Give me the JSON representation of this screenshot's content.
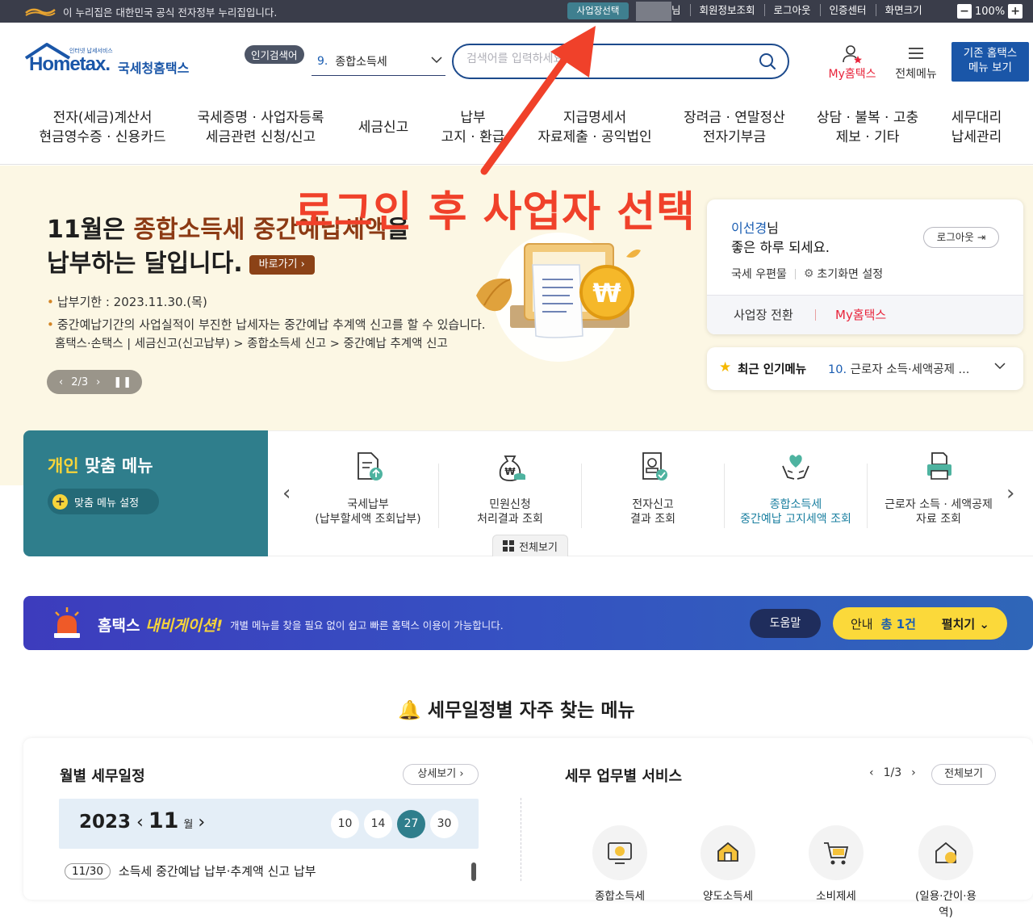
{
  "gov_bar": {
    "notice": "이 누리집은 대한민국 공식 전자정부 누리집입니다.",
    "biz_select": "사업장선택",
    "user_suffix": "님",
    "links": [
      "회원정보조회",
      "로그아웃",
      "인증센터",
      "화면크기"
    ],
    "zoom": "100%"
  },
  "header": {
    "logo_small": "인터넷 납세서비스",
    "logo_main": "Hometax.",
    "logo_kor": "국세청홈택스",
    "popular_label": "인기검색어",
    "popular_num": "9.",
    "popular_term": "종합소득세",
    "search_placeholder": "검색어를 입력하세요",
    "my_hometax": "My홈택스",
    "all_menu": "전체메뉴",
    "old_home_line1": "기존 홈택스",
    "old_home_line2": "메뉴 보기"
  },
  "gnb": [
    {
      "l1": "전자(세금)계산서",
      "l2": "현금영수증 · 신용카드"
    },
    {
      "l1": "국세증명 · 사업자등록",
      "l2": "세금관련 신청/신고"
    },
    {
      "l1": "세금신고",
      "l2": ""
    },
    {
      "l1": "납부",
      "l2": "고지 · 환급"
    },
    {
      "l1": "지급명세서",
      "l2": "자료제출 · 공익법인"
    },
    {
      "l1": "장려금 · 연말정산",
      "l2": "전자기부금"
    },
    {
      "l1": "상담 · 불복 · 고충",
      "l2": "제보 · 기타"
    },
    {
      "l1": "세무대리",
      "l2": "납세관리"
    }
  ],
  "banner": {
    "title_pre": "11월은 ",
    "title_hl": "종합소득세 중간예납세액",
    "title_post": "을",
    "title_line2": "납부하는 달입니다.",
    "go_label": "바로가기",
    "deadline": "납부기한 : 2023.11.30.(목)",
    "desc": "중간예납기간의 사업실적이 부진한 납세자는 중간예납 추계액 신고를 할 수 있습니다.",
    "path": "홈택스·손택스 | 세금신고(신고납부) > 종합소득세 신고 > 중간예납 추계액 신고",
    "slide_pos": "2/3"
  },
  "annotation": {
    "text": "로그인 후 사업자 선택",
    "color": "#f0412a"
  },
  "login": {
    "name": "이선경",
    "name_suffix": "님",
    "greeting": "좋은 하루 되세요.",
    "logout": "로그아웃",
    "mailbox": "국세 우편물",
    "init_setting": "초기화면 설정",
    "switch_biz": "사업장 전환",
    "my_hometax": "My홈택스"
  },
  "recent": {
    "label": "최근 인기메뉴",
    "num": "10.",
    "item": "근로자 소득·세액공제 ..."
  },
  "personal_menu": {
    "title_hl": "개인",
    "title_rest": " 맞춤 메뉴",
    "setting": "맞춤 메뉴 설정",
    "view_all": "전체보기",
    "items": [
      {
        "l1": "국세납부",
        "l2": "(납부할세액 조회납부)",
        "icon": "document-upload-icon"
      },
      {
        "l1": "민원신청",
        "l2": "처리결과 조회",
        "icon": "money-bag-icon"
      },
      {
        "l1": "전자신고",
        "l2": "결과 조회",
        "icon": "stamp-document-icon"
      },
      {
        "l1": "종합소득세",
        "l2": "중간예납 고지세액 조회",
        "icon": "heart-hands-icon",
        "highlight": true
      },
      {
        "l1": "근로자 소득 · 세액공제",
        "l2": "자료 조회",
        "icon": "printer-icon"
      }
    ]
  },
  "navigation": {
    "title_pre": "홈택스 ",
    "title_hl": "내비게이션!",
    "desc": "개별 메뉴를 찾을 필요 없이 쉽고 빠른 홈택스 이용이 가능합니다.",
    "help": "도움말",
    "notice_label": "안내",
    "notice_count": "총 1건",
    "expand": "펼치기"
  },
  "section_title": "세무일정별 자주 찾는 메뉴",
  "monthly": {
    "title": "월별 세무일정",
    "detail": "상세보기",
    "year": "2023",
    "month": "11",
    "month_unit": "월",
    "days": [
      "10",
      "14",
      "27",
      "30"
    ],
    "active_day": "27",
    "schedule_date": "11/30",
    "schedule_text": "소득세 중간예납 납부·추계액 신고 납부"
  },
  "services": {
    "title": "세무 업무별 서비스",
    "page": "1/3",
    "view_all": "전체보기",
    "items": [
      "종합소득세",
      "양도소득세",
      "소비제세",
      "(일용·간이·용역)"
    ]
  }
}
